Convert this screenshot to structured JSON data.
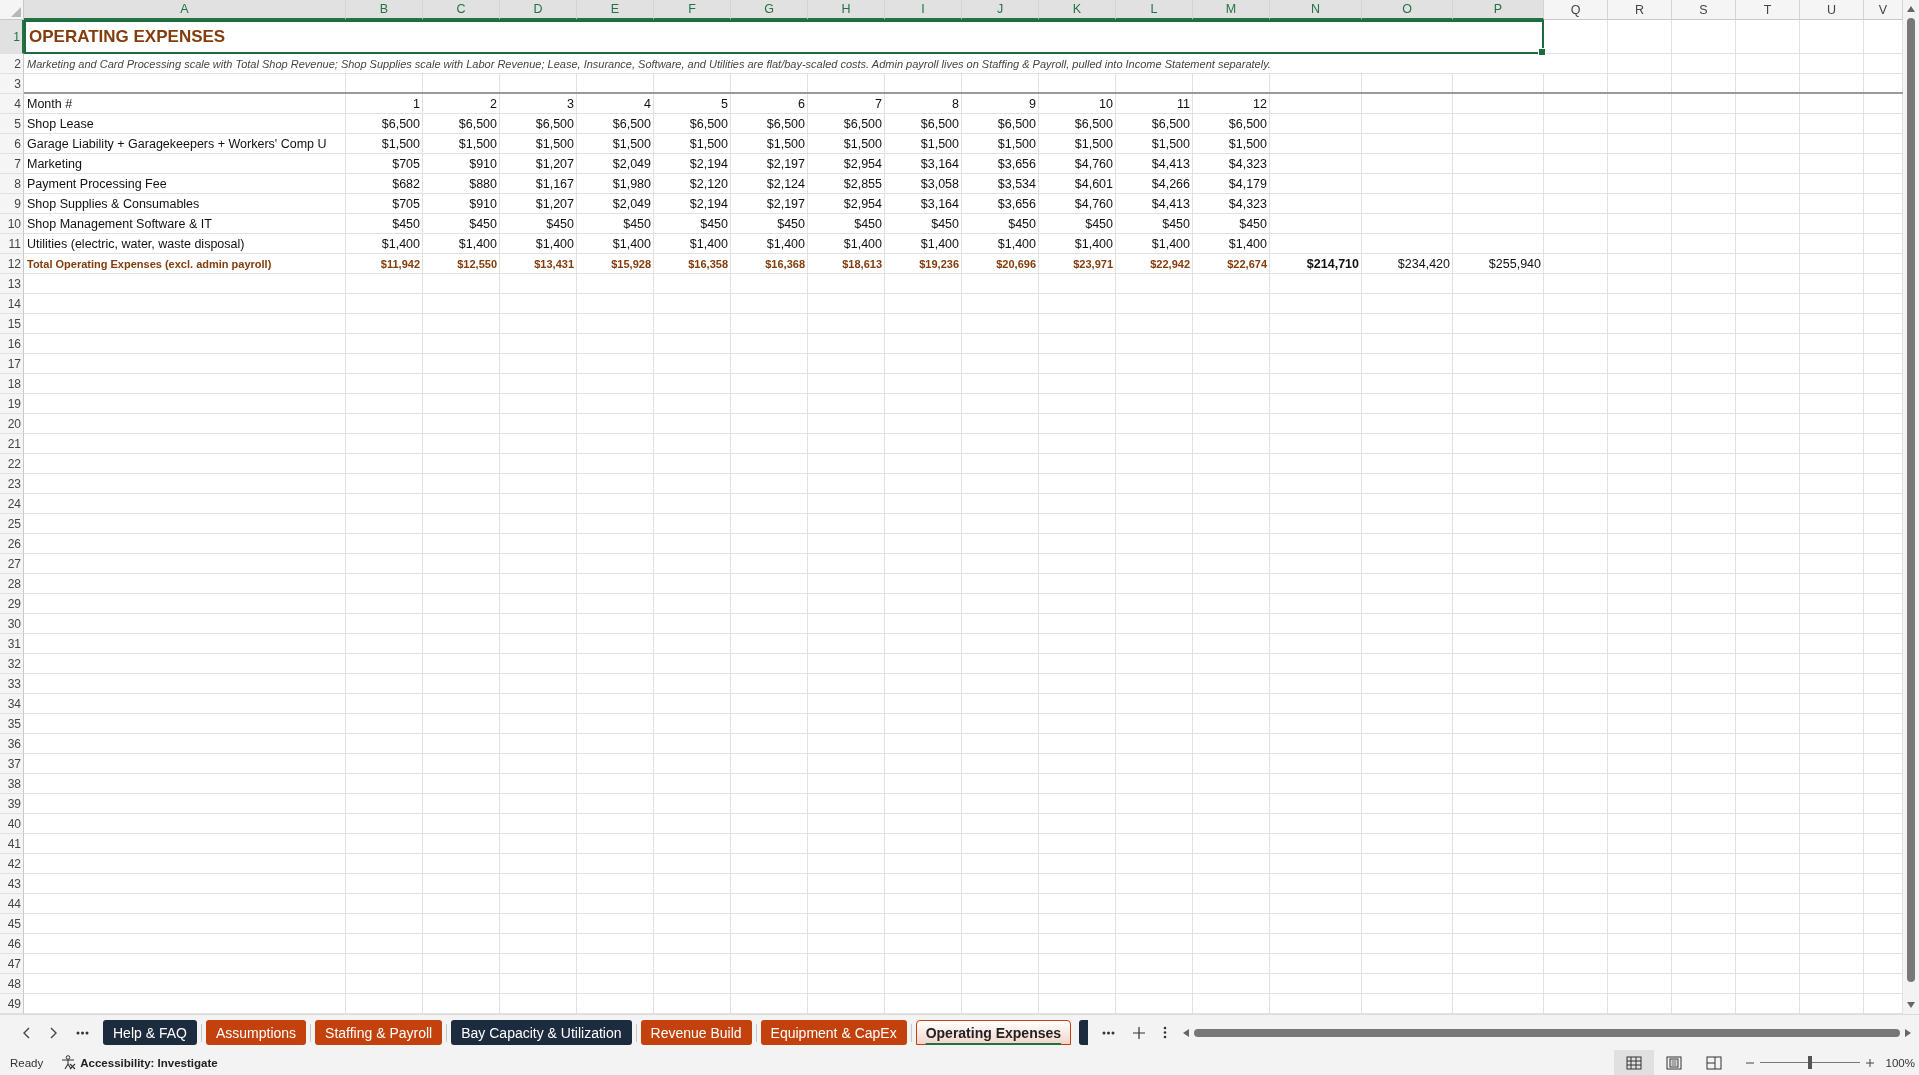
{
  "column_headers": [
    {
      "label": "A",
      "selected": true
    },
    {
      "label": "B",
      "selected": true
    },
    {
      "label": "C",
      "selected": true
    },
    {
      "label": "D",
      "selected": true
    },
    {
      "label": "E",
      "selected": true
    },
    {
      "label": "F",
      "selected": true
    },
    {
      "label": "G",
      "selected": true
    },
    {
      "label": "H",
      "selected": true
    },
    {
      "label": "I",
      "selected": true
    },
    {
      "label": "J",
      "selected": true
    },
    {
      "label": "K",
      "selected": true
    },
    {
      "label": "L",
      "selected": true
    },
    {
      "label": "M",
      "selected": true
    },
    {
      "label": "N",
      "selected": true
    },
    {
      "label": "O",
      "selected": true
    },
    {
      "label": "P",
      "selected": true
    },
    {
      "label": "Q",
      "selected": false
    },
    {
      "label": "R",
      "selected": false
    },
    {
      "label": "S",
      "selected": false
    },
    {
      "label": "T",
      "selected": false
    },
    {
      "label": "U",
      "selected": false
    },
    {
      "label": "V",
      "selected": false
    }
  ],
  "row_headers": [
    {
      "label": "1",
      "selected": true
    },
    {
      "label": "2",
      "selected": false
    },
    {
      "label": "3",
      "selected": false
    },
    {
      "label": "4",
      "selected": false
    },
    {
      "label": "5",
      "selected": false
    },
    {
      "label": "6",
      "selected": false
    },
    {
      "label": "7",
      "selected": false
    },
    {
      "label": "8",
      "selected": false
    },
    {
      "label": "9",
      "selected": false
    },
    {
      "label": "10",
      "selected": false
    },
    {
      "label": "11",
      "selected": false
    },
    {
      "label": "12",
      "selected": false
    },
    {
      "label": "13",
      "selected": false
    },
    {
      "label": "14",
      "selected": false
    },
    {
      "label": "15",
      "selected": false
    },
    {
      "label": "16",
      "selected": false
    },
    {
      "label": "17",
      "selected": false
    },
    {
      "label": "18",
      "selected": false
    },
    {
      "label": "19",
      "selected": false
    },
    {
      "label": "20",
      "selected": false
    },
    {
      "label": "21",
      "selected": false
    },
    {
      "label": "22",
      "selected": false
    },
    {
      "label": "23",
      "selected": false
    },
    {
      "label": "24",
      "selected": false
    },
    {
      "label": "25",
      "selected": false
    },
    {
      "label": "26",
      "selected": false
    },
    {
      "label": "27",
      "selected": false
    },
    {
      "label": "28",
      "selected": false
    },
    {
      "label": "29",
      "selected": false
    },
    {
      "label": "30",
      "selected": false
    },
    {
      "label": "31",
      "selected": false
    },
    {
      "label": "32",
      "selected": false
    },
    {
      "label": "33",
      "selected": false
    },
    {
      "label": "34",
      "selected": false
    },
    {
      "label": "35",
      "selected": false
    },
    {
      "label": "36",
      "selected": false
    },
    {
      "label": "37",
      "selected": false
    },
    {
      "label": "38",
      "selected": false
    },
    {
      "label": "39",
      "selected": false
    },
    {
      "label": "40",
      "selected": false
    },
    {
      "label": "41",
      "selected": false
    },
    {
      "label": "42",
      "selected": false
    },
    {
      "label": "43",
      "selected": false
    },
    {
      "label": "44",
      "selected": false
    },
    {
      "label": "45",
      "selected": false
    },
    {
      "label": "46",
      "selected": false
    },
    {
      "label": "47",
      "selected": false
    },
    {
      "label": "48",
      "selected": false
    },
    {
      "label": "49",
      "selected": false
    }
  ],
  "title": "OPERATING EXPENSES",
  "note": "Marketing and Card Processing scale with Total Shop Revenue; Shop Supplies scale with Labor Revenue; Lease, Insurance, Software, and Utilities are flat/bay-scaled costs. Admin payroll lives on Staffing & Payroll, pulled into Income Statement separately.",
  "month_row": {
    "label": "Month #",
    "values": [
      "1",
      "2",
      "3",
      "4",
      "5",
      "6",
      "7",
      "8",
      "9",
      "10",
      "11",
      "12"
    ]
  },
  "expense_rows": [
    {
      "label": "Shop Lease",
      "values": [
        "$6,500",
        "$6,500",
        "$6,500",
        "$6,500",
        "$6,500",
        "$6,500",
        "$6,500",
        "$6,500",
        "$6,500",
        "$6,500",
        "$6,500",
        "$6,500"
      ]
    },
    {
      "label": "Garage Liability + Garagekeepers + Workers' Comp U",
      "values": [
        "$1,500",
        "$1,500",
        "$1,500",
        "$1,500",
        "$1,500",
        "$1,500",
        "$1,500",
        "$1,500",
        "$1,500",
        "$1,500",
        "$1,500",
        "$1,500"
      ]
    },
    {
      "label": "Marketing",
      "values": [
        "$705",
        "$910",
        "$1,207",
        "$2,049",
        "$2,194",
        "$2,197",
        "$2,954",
        "$3,164",
        "$3,656",
        "$4,760",
        "$4,413",
        "$4,323"
      ]
    },
    {
      "label": "Payment Processing Fee",
      "values": [
        "$682",
        "$880",
        "$1,167",
        "$1,980",
        "$2,120",
        "$2,124",
        "$2,855",
        "$3,058",
        "$3,534",
        "$4,601",
        "$4,266",
        "$4,179"
      ]
    },
    {
      "label": "Shop Supplies & Consumables",
      "values": [
        "$705",
        "$910",
        "$1,207",
        "$2,049",
        "$2,194",
        "$2,197",
        "$2,954",
        "$3,164",
        "$3,656",
        "$4,760",
        "$4,413",
        "$4,323"
      ]
    },
    {
      "label": "Shop Management Software & IT",
      "values": [
        "$450",
        "$450",
        "$450",
        "$450",
        "$450",
        "$450",
        "$450",
        "$450",
        "$450",
        "$450",
        "$450",
        "$450"
      ]
    },
    {
      "label": "Utilities (electric, water, waste disposal)",
      "values": [
        "$1,400",
        "$1,400",
        "$1,400",
        "$1,400",
        "$1,400",
        "$1,400",
        "$1,400",
        "$1,400",
        "$1,400",
        "$1,400",
        "$1,400",
        "$1,400"
      ]
    }
  ],
  "total_row": {
    "label": "Total Operating Expenses (excl. admin payroll)",
    "values": [
      "$11,942",
      "$12,550",
      "$13,431",
      "$15,928",
      "$16,358",
      "$16,368",
      "$18,613",
      "$19,236",
      "$20,696",
      "$23,971",
      "$22,942",
      "$22,674"
    ],
    "annual_totals": [
      {
        "value": "$214,710",
        "bold": true
      },
      {
        "value": "$234,420",
        "bold": false
      },
      {
        "value": "$255,940",
        "bold": false
      }
    ]
  },
  "sheet_tabs": [
    {
      "label": "Help & FAQ",
      "color": "#1d2b3e",
      "selected": false
    },
    {
      "label": "Assumptions",
      "color": "#c2410c",
      "selected": false
    },
    {
      "label": "Staffing & Payroll",
      "color": "#c2410c",
      "selected": false
    },
    {
      "label": "Bay Capacity & Utilization",
      "color": "#1d2b3e",
      "selected": false
    },
    {
      "label": "Revenue Build",
      "color": "#c2410c",
      "selected": false
    },
    {
      "label": "Equipment & CapEx",
      "color": "#c2410c",
      "selected": false
    },
    {
      "label": "Operating Expenses",
      "color": "#c2410c",
      "selected": true
    }
  ],
  "partial_tab": {
    "color": "#1d2b3e"
  },
  "status_bar": {
    "status": "Ready",
    "accessibility": "Accessibility: Investigate",
    "views": [
      {
        "kind": "normal",
        "selected": true
      },
      {
        "kind": "page-layout",
        "selected": false
      },
      {
        "kind": "page-break",
        "selected": false
      }
    ],
    "zoom_slider": {
      "level": 0.5
    },
    "zoom": "100%"
  }
}
